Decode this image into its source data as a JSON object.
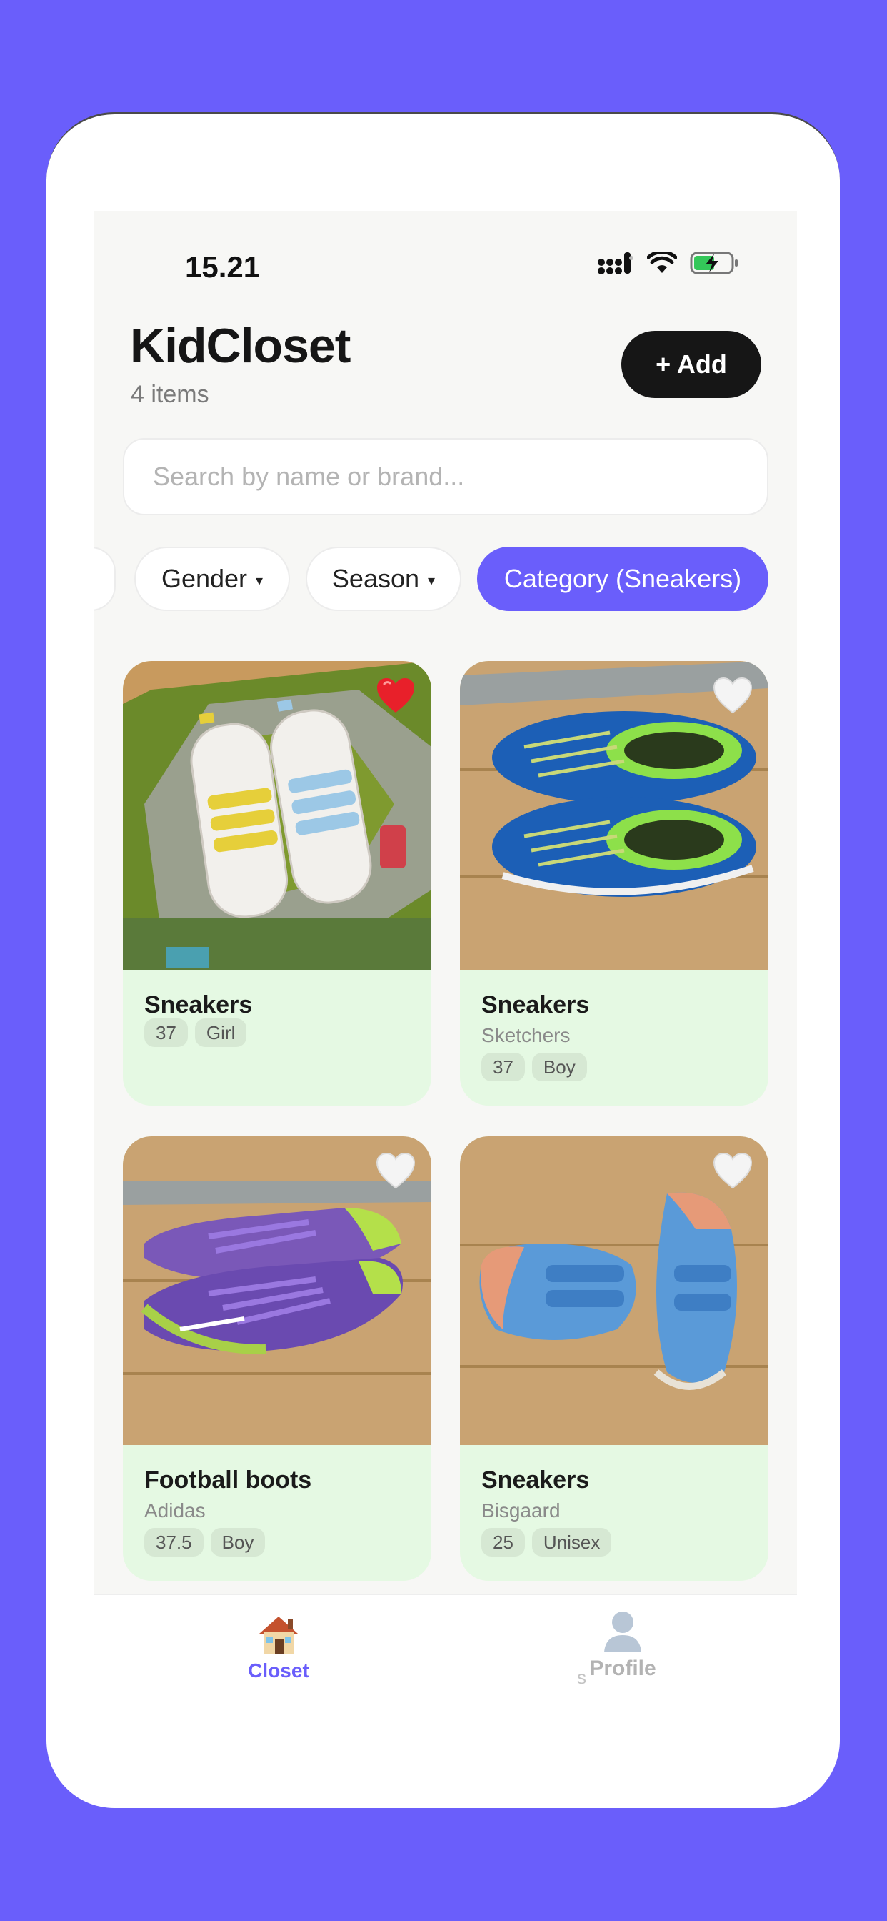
{
  "status_bar": {
    "time": "15.21"
  },
  "header": {
    "title": "KidCloset",
    "item_count": "4 items",
    "add_label": "+ Add"
  },
  "search": {
    "placeholder": "Search by name or brand..."
  },
  "filters": {
    "chips": [
      {
        "label": "Gender"
      },
      {
        "label": "Season"
      },
      {
        "label": "Category (Sneakers)"
      }
    ],
    "caret": "▾"
  },
  "items": [
    {
      "name": "Sneakers",
      "brand": "",
      "size": "37",
      "gender": "Girl",
      "favorite": true
    },
    {
      "name": "Sneakers",
      "brand": "Sketchers",
      "size": "37",
      "gender": "Boy",
      "favorite": false
    },
    {
      "name": "Football boots",
      "brand": "Adidas",
      "size": "37.5",
      "gender": "Boy",
      "favorite": false
    },
    {
      "name": "Sneakers",
      "brand": "Bisgaard",
      "size": "25",
      "gender": "Unisex",
      "favorite": false
    }
  ],
  "tabbar": {
    "tabs": [
      {
        "label": "Closet",
        "icon": "house-icon",
        "active": true
      },
      {
        "label": "Profile",
        "icon": "person-icon",
        "active": false
      }
    ],
    "ghost_text": "s"
  },
  "colors": {
    "accent": "#6A5EFB",
    "card_bg": "#E5F9E3",
    "dark": "#161616"
  }
}
